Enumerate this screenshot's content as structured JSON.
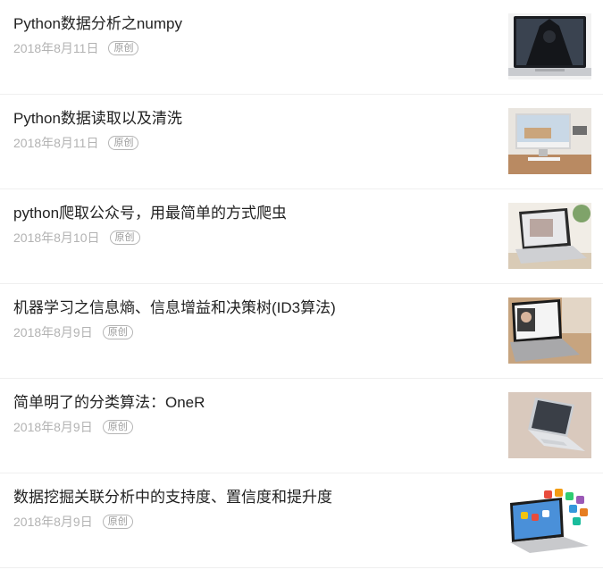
{
  "articles": [
    {
      "title": "Python数据分析之numpy",
      "date": "2018年8月11日",
      "badge": "原创",
      "thumb_icon": "laptop-batman-image"
    },
    {
      "title": "Python数据读取以及清洗",
      "date": "2018年8月11日",
      "badge": "原创",
      "thumb_icon": "desktop-monitor-image"
    },
    {
      "title": "python爬取公众号，用最简单的方式爬虫",
      "date": "2018年8月10日",
      "badge": "原创",
      "thumb_icon": "laptop-desk-image"
    },
    {
      "title": "机器学习之信息熵、信息增益和决策树(ID3算法)",
      "date": "2018年8月9日",
      "badge": "原创",
      "thumb_icon": "laptop-wood-desk-image"
    },
    {
      "title": "简单明了的分类算法：OneR",
      "date": "2018年8月9日",
      "badge": "原创",
      "thumb_icon": "laptop-silver-image"
    },
    {
      "title": "数据挖掘关联分析中的支持度、置信度和提升度",
      "date": "2018年8月9日",
      "badge": "原创",
      "thumb_icon": "laptop-apps-image"
    }
  ]
}
